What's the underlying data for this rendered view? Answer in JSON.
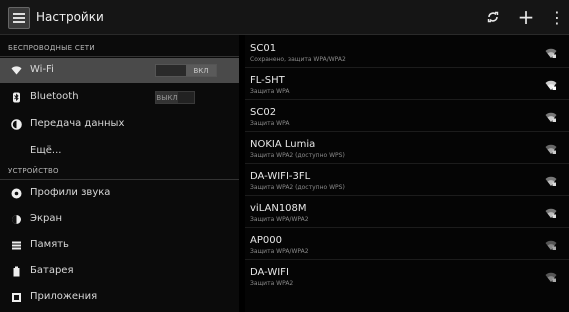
{
  "app": {
    "title": "Настройки"
  },
  "toolbar": {
    "sync_icon": "sync-icon",
    "add_label": "+",
    "menu_label": "⋮"
  },
  "left": {
    "section_wireless": "БЕСПРОВОДНЫЕ СЕТИ",
    "section_device": "УСТРОЙСТВО",
    "items": [
      {
        "label": "Wi-Fi",
        "icon": "wifi-icon",
        "toggle": "ВКЛ",
        "selected": true
      },
      {
        "label": "Bluetooth",
        "icon": "bluetooth-icon",
        "toggle": "ВЫКЛ"
      },
      {
        "label": "Передача данных",
        "icon": "data-usage-icon"
      },
      {
        "label": "Ещё..."
      },
      {
        "label": "Профили звука",
        "icon": "sound-icon"
      },
      {
        "label": "Экран",
        "icon": "display-icon"
      },
      {
        "label": "Память",
        "icon": "storage-icon"
      },
      {
        "label": "Батарея",
        "icon": "battery-icon"
      },
      {
        "label": "Приложения",
        "icon": "apps-icon"
      }
    ]
  },
  "networks": [
    {
      "ssid": "SC01",
      "security": "Сохранено, защита WPA/WPA2"
    },
    {
      "ssid": "FL-SHT",
      "security": "Защита WPA"
    },
    {
      "ssid": "SC02",
      "security": "Защита WPA"
    },
    {
      "ssid": "NOKIA Lumia",
      "security": "Защита WPA2 (доступно WPS)"
    },
    {
      "ssid": "DA-WIFI-3FL",
      "security": "Защита WPA2 (доступно WPS)"
    },
    {
      "ssid": "viLAN108M",
      "security": "Защита WPA/WPA2"
    },
    {
      "ssid": "AP000",
      "security": "Защита WPA/WPA2"
    },
    {
      "ssid": "DA-WIFI",
      "security": "Защита WPA2"
    }
  ]
}
